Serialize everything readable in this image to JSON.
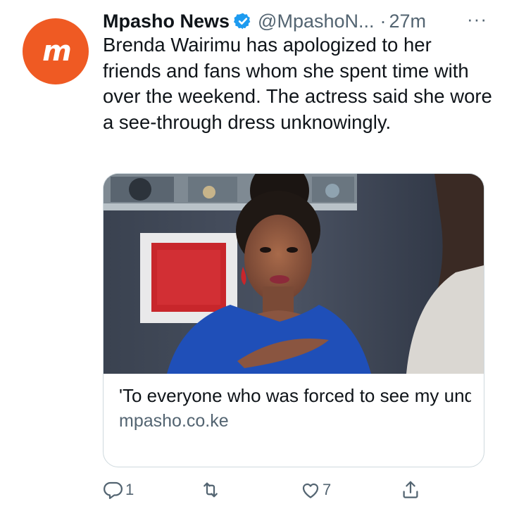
{
  "tweet": {
    "avatar_icon": "mpasho-logo-icon",
    "avatar_text": "m",
    "display_name": "Mpasho News",
    "verified_icon": "verified-badge-icon",
    "handle": "@MpashoN...",
    "separator": "·",
    "time": "27m",
    "more_icon": "more-options-icon",
    "more_text": "···",
    "text": "Brenda Wairimu has apologized to her friends and fans whom she spent time with over the weekend. The actress said she wore a see-through dress unknowingly."
  },
  "card": {
    "title": "'To everyone who was forced to see my underwear,' Brenda Wairimu apo...",
    "domain": "mpasho.co.ke"
  },
  "actions": {
    "reply": {
      "icon": "reply-icon",
      "count": "1"
    },
    "retweet": {
      "icon": "retweet-icon",
      "count": ""
    },
    "like": {
      "icon": "heart-icon",
      "count": "7"
    },
    "share": {
      "icon": "share-icon"
    }
  },
  "colors": {
    "brand": "#ef5a23",
    "verified": "#1d9bf0",
    "muted": "#536471",
    "text": "#0f1419",
    "dress": "#1f4fb8"
  }
}
